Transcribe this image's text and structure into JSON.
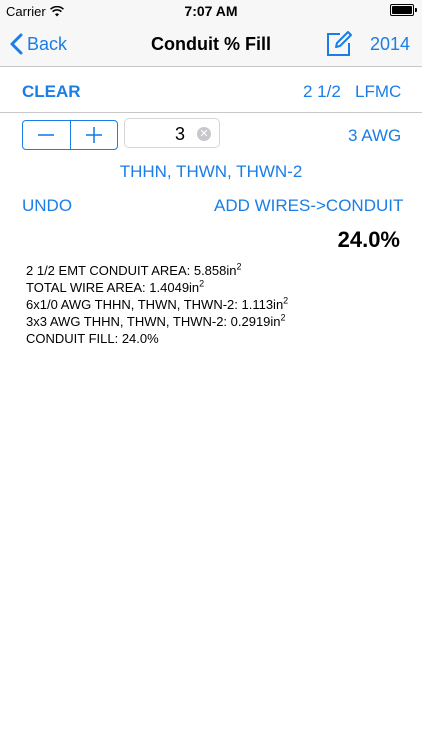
{
  "status_bar": {
    "carrier": "Carrier",
    "time": "7:07 AM"
  },
  "nav": {
    "back_label": "Back",
    "title": "Conduit % Fill",
    "year": "2014"
  },
  "toolbar": {
    "clear_label": "CLEAR",
    "conduit_size": "2 1/2",
    "conduit_type": "LFMC"
  },
  "wire_entry": {
    "quantity": "3",
    "awg": "3 AWG",
    "insulation": "THHN, THWN, THWN-2",
    "undo_label": "UNDO",
    "add_label": "ADD WIRES->CONDUIT"
  },
  "result": {
    "fill_percent": "24.0%"
  },
  "details": [
    {
      "text": "2 1/2 EMT CONDUIT AREA: 5.858in",
      "sup": "2"
    },
    {
      "text": "TOTAL WIRE AREA: 1.4049in",
      "sup": "2"
    },
    {
      "text": "6x1/0 AWG THHN, THWN, THWN-2: 1.113in",
      "sup": "2"
    },
    {
      "text": "3x3 AWG THHN, THWN, THWN-2: 0.2919in",
      "sup": "2"
    },
    {
      "text": "CONDUIT FILL: 24.0%",
      "sup": ""
    }
  ],
  "colors": {
    "accent": "#1a7ee6",
    "bar_bg": "#f7f7f7"
  },
  "icons": {
    "back": "chevron-left-icon",
    "compose": "compose-icon",
    "wifi": "wifi-icon",
    "battery": "battery-icon",
    "clear_field": "clear-x-icon"
  }
}
